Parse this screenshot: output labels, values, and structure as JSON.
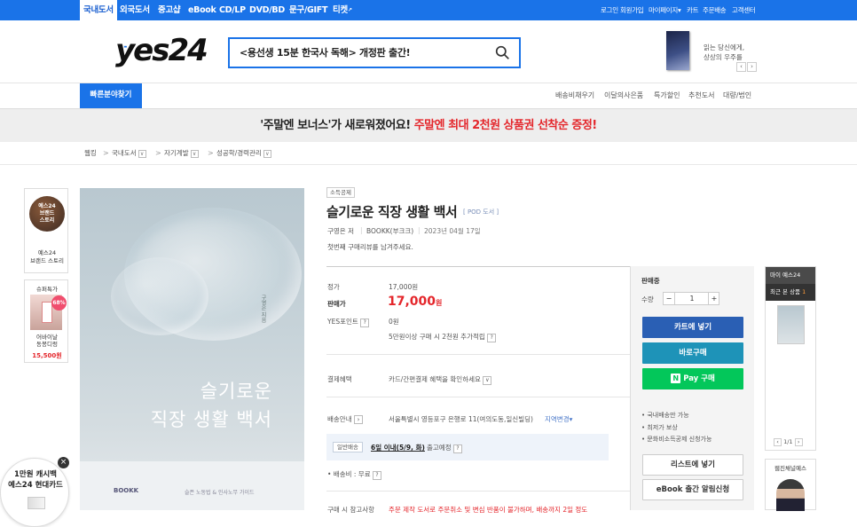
{
  "topnav": {
    "categories": [
      "국내도서",
      "외국도서",
      "중고샵",
      "eBook",
      "CD/LP",
      "DVD/BD",
      "문구/GIFT",
      "티켓"
    ],
    "ticket_arrow": "↗",
    "utils": [
      "로그인",
      "회원가입",
      "마이페이지",
      "카트",
      "주문배송",
      "고객센터"
    ],
    "util_dropdown": "▾"
  },
  "header": {
    "logo": "yes24",
    "logo_dots": "··",
    "search_query": "<용선생 15분 한국사 독해> 개정판 출간!",
    "ad_text_1": "읽는 당신에게,",
    "ad_text_2": "상상의 우주를",
    "ad_prev": "‹",
    "ad_next": "›"
  },
  "subnav": {
    "quick_find": "빠른분야찾기",
    "links": [
      "배송비채우기",
      "이달의사은품",
      "특가할인",
      "추천도서",
      "대량/법인"
    ]
  },
  "banner": {
    "text_black": "'주말엔 보너스'가 새로워졌어요!",
    "text_red": "주말엔 최대 2천원 상품권 선착순 증정!"
  },
  "breadcrumb": {
    "home": "웹킹",
    "items": [
      "국내도서",
      "자기계발",
      "성공학/경력관리"
    ],
    "dropdown": "∨",
    "sep": ">"
  },
  "left_sidebar": {
    "brand_circle": "예스24\n브랜드\n스토리",
    "brand_label_1": "예스24",
    "brand_label_2": "브랜드 스토리",
    "deal_title": "슈퍼특가",
    "deal_badge": "68%",
    "deal_name_1": "어바이날",
    "deal_name_2": "동봉디렁",
    "deal_price": "15,500원"
  },
  "popup": {
    "line1": "1만원 캐시백",
    "line2": "예스24 현대카드",
    "close": "×"
  },
  "book_cover": {
    "title_1": "슬기로운",
    "title_2": "직장 생활 백서",
    "vertical_author": "구영은 지음",
    "publisher": "BOOKK",
    "subtitle": "슬픈 노동법 & 인사노무 가이드"
  },
  "product": {
    "badge": "소득공제",
    "title": "슬기로운 직장 생활 백서",
    "format": "[ POD 도서 ]",
    "author": "구영은 저",
    "publisher": "BOOKK(부크크)",
    "date": "2023년 04월 17일",
    "review_prompt": "첫번째 구매리뷰를 남겨주세요.",
    "list_price_label": "정가",
    "list_price": "17,000원",
    "sale_price_label": "판매가",
    "sale_price": "17,000",
    "sale_price_unit": "원",
    "points_label": "YES포인트",
    "help": "?",
    "points_value": "0원",
    "points_extra": "5만원이상 구매 시 2천원 추가적립",
    "payment_label": "결제혜택",
    "payment_value": "카드/간편결제 혜택을 확인하세요",
    "shipping_label": "배송안내",
    "shipping_arrow": "›",
    "shipping_addr": "서울특별시 영등포구 은행로 11(여의도동,일신빌딩)",
    "shipping_change": "지역변경",
    "delivery_type": "일반배송",
    "delivery_date": "6일 이내(5/9, 화)",
    "delivery_suffix": "출고예정",
    "shipping_fee": "• 배송비 : 무료",
    "bottom_label": "구매 시 참고사항",
    "bottom_text": "주문 제작 도서로 주문취소 및 변심 반품이 불가하며, 배송까지 2일 정도"
  },
  "buybox": {
    "status": "판매중",
    "qty_label": "수량",
    "qty_minus": "−",
    "qty": "1",
    "qty_plus": "+",
    "cart_btn": "카트에 넣기",
    "buy_btn": "바로구매",
    "naver_n": "N",
    "naver_btn": "Pay 구매",
    "notes": [
      "• 국내배송만 가능",
      "• 최저가 보상",
      "• 문화비소득공제 신청가능"
    ],
    "wishlist_btn": "리스트에 넣기",
    "ebook_btn": "eBook 출간 알림신청"
  },
  "right_panel": {
    "title_1": "마이 예스24",
    "title_2": "최근 본 상품",
    "count": "1",
    "page": "1/1",
    "prev": "‹",
    "next": "›",
    "section2": "웹진채널예스"
  },
  "colors": {
    "brand_blue": "#1a73e8",
    "sale_red": "#e4262b",
    "cart_blue": "#2a5fb4",
    "buy_teal": "#1e93b8",
    "naver_green": "#03c75a"
  }
}
